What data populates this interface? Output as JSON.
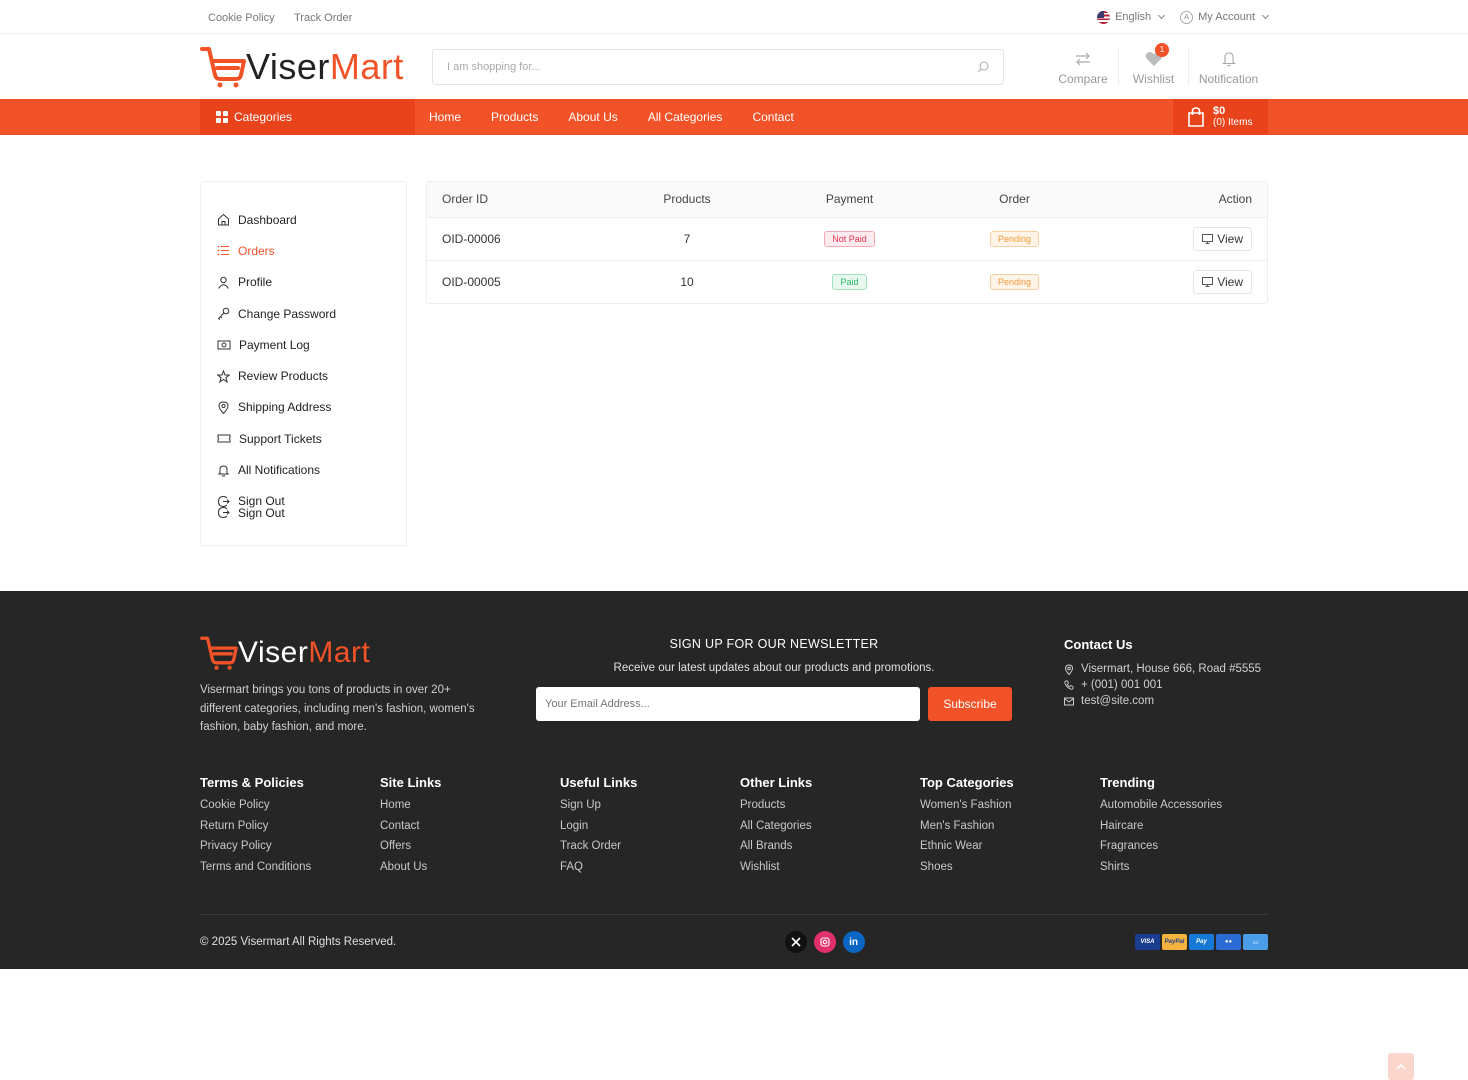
{
  "topbar": {
    "links": [
      "Cookie Policy",
      "Track Order"
    ],
    "language": "English",
    "account": "My Account"
  },
  "brand": {
    "name_part1": "Viser",
    "name_part2": "Mart"
  },
  "search": {
    "placeholder": "I am shopping for..."
  },
  "header_actions": {
    "compare": "Compare",
    "wishlist": "Wishlist",
    "wishlist_count": "1",
    "notification": "Notification"
  },
  "nav": {
    "categories": "Categories",
    "links": [
      "Home",
      "Products",
      "About Us",
      "All Categories",
      "Contact"
    ],
    "cart_amount": "$0",
    "cart_items": "(0) Items"
  },
  "sidebar": {
    "items": [
      {
        "label": "Dashboard",
        "icon": "home-icon"
      },
      {
        "label": "Orders",
        "icon": "list-icon",
        "active": true
      },
      {
        "label": "Profile",
        "icon": "user-icon"
      },
      {
        "label": "Change Password",
        "icon": "key-icon"
      },
      {
        "label": "Payment Log",
        "icon": "money-icon"
      },
      {
        "label": "Review Products",
        "icon": "star-icon"
      },
      {
        "label": "Shipping Address",
        "icon": "location-icon"
      },
      {
        "label": "Support Tickets",
        "icon": "ticket-icon"
      },
      {
        "label": "All Notifications",
        "icon": "bell-icon"
      },
      {
        "label": "Sign Out",
        "icon": "sign-out-icon"
      },
      {
        "label": "Sign Out",
        "icon": "sign-out-icon"
      }
    ]
  },
  "orders": {
    "headers": [
      "Order ID",
      "Products",
      "Payment",
      "Order",
      "Action"
    ],
    "rows": [
      {
        "id": "OID-00006",
        "products": "7",
        "payment": "Not Paid",
        "order": "Pending",
        "action": "View"
      },
      {
        "id": "OID-00005",
        "products": "10",
        "payment": "Paid",
        "order": "Pending",
        "action": "View"
      }
    ]
  },
  "footer": {
    "description": "Visermart brings you tons of products in over 20+ different categories, including men's fashion, women's fashion, baby fashion, and more.",
    "newsletter_title": "SIGN UP FOR OUR NEWSLETTER",
    "newsletter_text": "Receive our latest updates about our products and promotions.",
    "email_placeholder": "Your Email Address...",
    "subscribe": "Subscribe",
    "contact_title": "Contact Us",
    "address": "Visermart, House 666, Road #5555",
    "phone": "+ (001) 001 001",
    "email": "test@site.com",
    "columns": [
      {
        "title": "Terms & Policies",
        "links": [
          "Cookie Policy",
          "Return Policy",
          "Privacy Policy",
          "Terms and Conditions"
        ]
      },
      {
        "title": "Site Links",
        "links": [
          "Home",
          "Contact",
          "Offers",
          "About Us"
        ]
      },
      {
        "title": "Useful Links",
        "links": [
          "Sign Up",
          "Login",
          "Track Order",
          "FAQ"
        ]
      },
      {
        "title": "Other Links",
        "links": [
          "Products",
          "All Categories",
          "All Brands",
          "Wishlist"
        ]
      },
      {
        "title": "Top Categories",
        "links": [
          "Women's Fashion",
          "Men's Fashion",
          "Ethnic Wear",
          "Shoes"
        ]
      },
      {
        "title": "Trending",
        "links": [
          "Automobile Accessories",
          "Haircare",
          "Fragrances",
          "Shirts"
        ]
      }
    ],
    "copyright": "© 2025 Visermart All Rights Reserved.",
    "socials": [
      "x-icon",
      "instagram-icon",
      "linkedin-icon"
    ],
    "payments": [
      "VISA",
      "PayPal",
      "Payoneer",
      "Maestro",
      "Card"
    ]
  },
  "colors": {
    "accent": "#f25227",
    "accent_dark": "#e8431b",
    "footer_bg": "#262626"
  }
}
